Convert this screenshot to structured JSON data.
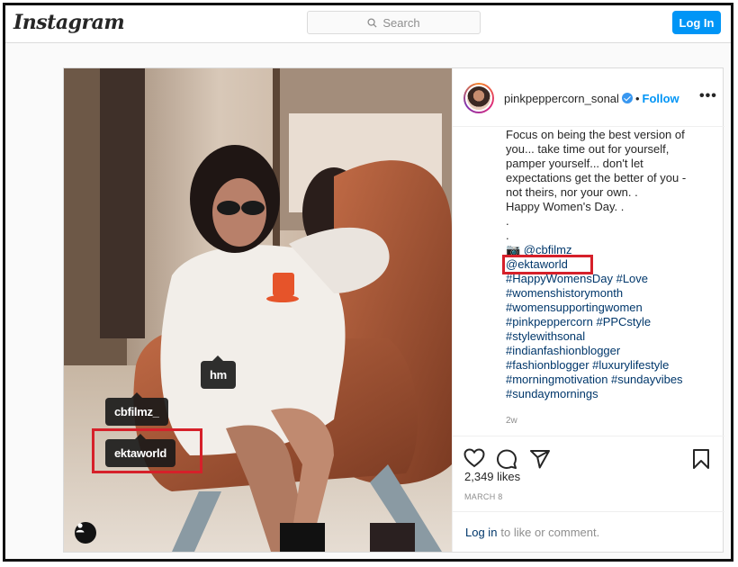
{
  "header": {
    "logo": "Instagram",
    "search_placeholder": "Search",
    "login_label": "Log In"
  },
  "photo": {
    "tags": [
      "hm",
      "cbfilmz_",
      "ektaworld"
    ]
  },
  "post": {
    "username": "pinkpeppercorn_sonal",
    "separator": "•",
    "follow_label": "Follow",
    "more_label": "•••",
    "caption_lines": [
      "Focus on being the best version of",
      "you... take time out for yourself,",
      "pamper yourself... don't let",
      "expectations get the better of you -",
      "not theirs, nor your own. .",
      "Happy Women's Day. .",
      ".",
      "."
    ],
    "credit": "📷 @cbfilmz",
    "mention": "@ektaworld",
    "hashtags": [
      "#HappyWomensDay #Love",
      "#womenshistorymonth",
      "#womensupportingwomen",
      "#pinkpeppercorn #PPCstyle",
      "#stylewithsonal",
      "#indianfashionblogger",
      "#fashionblogger #luxurylifestyle",
      "#morningmotivation #sundayvibes",
      "#sundaymornings"
    ],
    "age": "2w",
    "likes": "2,349 likes",
    "date": "MARCH 8",
    "comment_login": "Log in",
    "comment_rest": "to like or comment."
  },
  "colors": {
    "accent": "#0095f6",
    "highlight": "#d6202a"
  }
}
